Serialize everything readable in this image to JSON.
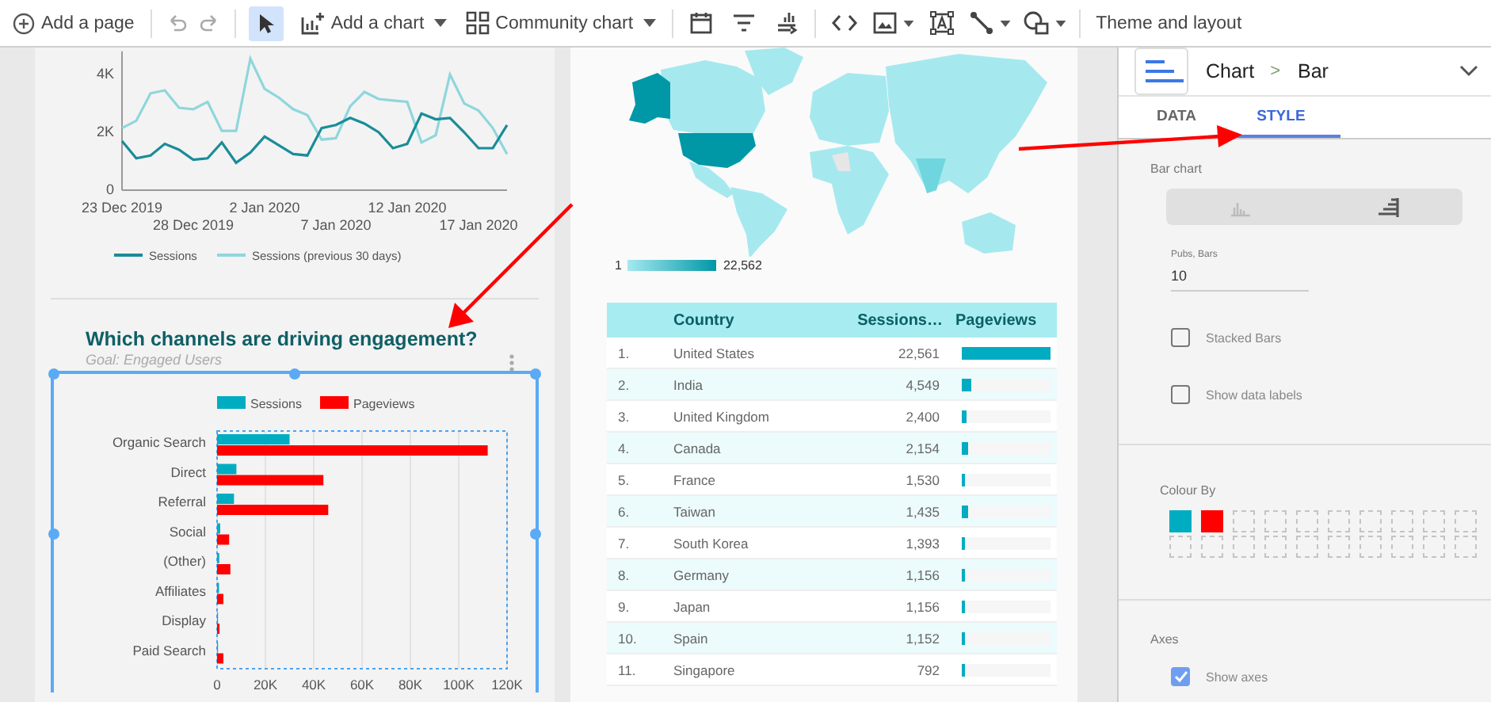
{
  "toolbar": {
    "add_page": "Add a page",
    "pointer_selected": true,
    "add_chart": "Add a chart",
    "community_chart": "Community chart",
    "theme": "Theme and layout"
  },
  "line_chart": {
    "chart_data": {
      "type": "line",
      "categories": [
        "23 Dec 2019",
        null,
        null,
        null,
        null,
        "28 Dec 2019",
        null,
        null,
        null,
        null,
        "2 Jan 2020",
        null,
        null,
        null,
        null,
        "7 Jan 2020",
        null,
        null,
        null,
        null,
        "12 Jan 2020",
        null,
        null,
        null,
        null,
        "17 Jan 2020",
        null,
        null
      ],
      "ylim": [
        0,
        4800
      ],
      "legend": "bottom",
      "yticks": [
        {
          "value": 0,
          "label": "0"
        },
        {
          "value": 2000,
          "label": "2K"
        },
        {
          "value": 4000,
          "label": "4K"
        }
      ],
      "series": [
        {
          "name": "Sessions",
          "color": "#1a8c98",
          "values": [
            1700,
            1100,
            1200,
            1600,
            1400,
            1050,
            1100,
            1650,
            950,
            1300,
            1850,
            1550,
            1250,
            1200,
            2150,
            2250,
            2500,
            2300,
            2000,
            1450,
            1600,
            2650,
            2450,
            2500,
            2000,
            1450,
            1450,
            2250
          ]
        },
        {
          "name": "Sessions (previous 30 days)",
          "color": "#8fd6dc",
          "values": [
            2150,
            2400,
            3350,
            3450,
            2850,
            2800,
            3050,
            2050,
            2050,
            4550,
            3500,
            3200,
            2800,
            2600,
            1750,
            1800,
            2900,
            3400,
            3150,
            3100,
            3050,
            1650,
            1900,
            4000,
            3000,
            2750,
            2150,
            1250
          ]
        }
      ]
    }
  },
  "bar_card": {
    "title": "Which channels are driving engagement?",
    "subtitle": "Goal: Engaged Users",
    "selected": true,
    "chart_data": {
      "type": "bar",
      "orientation": "horizontal",
      "grid": true,
      "legend": "top",
      "categories": [
        "Organic Search",
        "Direct",
        "Referral",
        "Social",
        "(Other)",
        "Affiliates",
        "Display",
        "Paid Search"
      ],
      "xlim": [
        0,
        120000
      ],
      "xticks": [
        {
          "value": 0,
          "label": "0"
        },
        {
          "value": 20000,
          "label": "20K"
        },
        {
          "value": 40000,
          "label": "40K"
        },
        {
          "value": 60000,
          "label": "60K"
        },
        {
          "value": 80000,
          "label": "80K"
        },
        {
          "value": 100000,
          "label": "100K"
        },
        {
          "value": 120000,
          "label": "120K"
        }
      ],
      "series": [
        {
          "name": "Sessions",
          "color": "#00acc1",
          "values": [
            30000,
            8000,
            7000,
            1300,
            900,
            800,
            300,
            200
          ]
        },
        {
          "name": "Pageviews",
          "color": "#ff0000",
          "values": [
            112000,
            44000,
            46000,
            5000,
            5500,
            2600,
            1000,
            2600
          ]
        }
      ]
    }
  },
  "map": {
    "legend_min": "1",
    "legend_max": "22,562"
  },
  "table": {
    "columns": [
      "Country",
      "Sessions…",
      "Pageviews"
    ],
    "rows": [
      {
        "index": "1.",
        "country": "United States",
        "sessions": "22,561",
        "level": 1.0
      },
      {
        "index": "2.",
        "country": "India",
        "sessions": "4,549",
        "level": 0.1
      },
      {
        "index": "3.",
        "country": "United Kingdom",
        "sessions": "2,400",
        "level": 0.05
      },
      {
        "index": "4.",
        "country": "Canada",
        "sessions": "2,154",
        "level": 0.08
      },
      {
        "index": "5.",
        "country": "France",
        "sessions": "1,530",
        "level": 0.02
      },
      {
        "index": "6.",
        "country": "Taiwan",
        "sessions": "1,435",
        "level": 0.07
      },
      {
        "index": "7.",
        "country": "South Korea",
        "sessions": "1,393",
        "level": 0.04
      },
      {
        "index": "8.",
        "country": "Germany",
        "sessions": "1,156",
        "level": 0.03
      },
      {
        "index": "9.",
        "country": "Japan",
        "sessions": "1,156",
        "level": 0.04
      },
      {
        "index": "10.",
        "country": "Spain",
        "sessions": "1,152",
        "level": 0.02
      },
      {
        "index": "11.",
        "country": "Singapore",
        "sessions": "792",
        "level": 0.02
      }
    ]
  },
  "panel": {
    "crumb": "Chart",
    "separator": ">",
    "type": "Bar",
    "tabs": [
      {
        "label": "DATA",
        "selected": false
      },
      {
        "label": "STYLE",
        "selected": true
      }
    ],
    "bar_chart_label": "Bar chart",
    "orientations": [
      {
        "kind": "vertical",
        "selected": false
      },
      {
        "kind": "horizontal",
        "selected": true
      }
    ],
    "bars_field": {
      "label": "Pubs, Bars",
      "value": "10"
    },
    "options": [
      {
        "label": "Stacked Bars",
        "checked": false
      },
      {
        "label": "Show data labels",
        "checked": false
      }
    ],
    "colour_by": {
      "label": "Colour By",
      "swatches": [
        {
          "filled": true,
          "color": "#00acc1"
        },
        {
          "filled": true,
          "color": "#ff0000"
        },
        {
          "filled": false
        },
        {
          "filled": false
        },
        {
          "filled": false
        },
        {
          "filled": false
        },
        {
          "filled": false
        },
        {
          "filled": false
        },
        {
          "filled": false
        },
        {
          "filled": false
        },
        {
          "filled": false
        },
        {
          "filled": false
        },
        {
          "filled": false
        },
        {
          "filled": false
        },
        {
          "filled": false
        },
        {
          "filled": false
        },
        {
          "filled": false
        },
        {
          "filled": false
        },
        {
          "filled": false
        },
        {
          "filled": false
        }
      ]
    },
    "axes": {
      "label": "Axes",
      "options": [
        {
          "label": "Show axes",
          "checked": true
        }
      ]
    }
  }
}
